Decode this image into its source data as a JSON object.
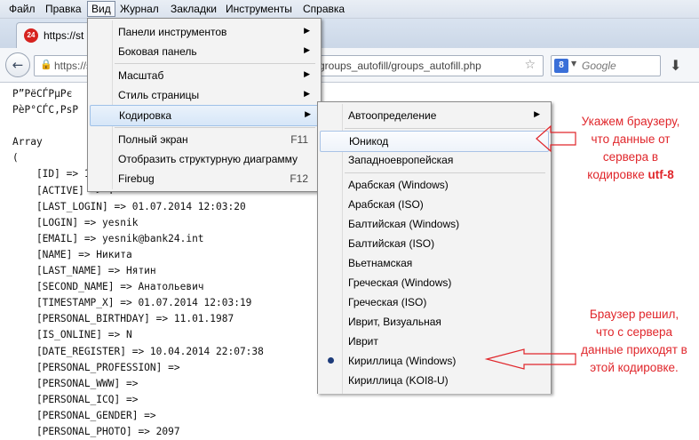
{
  "menubar": {
    "items": [
      "Файл",
      "Правка",
      "Вид",
      "Журнал",
      "Закладки",
      "Инструменты",
      "Справка"
    ],
    "active": "Вид"
  },
  "tab": {
    "favicon_text": "24",
    "title": "https://st"
  },
  "navbar": {
    "url_visible_start": "https://s",
    "url_visible_end": "groups_autofill/groups_autofill.php",
    "search_placeholder": "Google",
    "search_engine_icon": "google-icon",
    "download_icon": "download-arrow-icon"
  },
  "page": {
    "lines": [
      "Р”РёСЃРµРє",
      "РѐР°СЃС‚РѕР",
      "",
      "Array",
      "(",
      "    [ID] => 1",
      "    [ACTIVE] => Y",
      "    [LAST_LOGIN] => 01.07.2014 12:03:20",
      "    [LOGIN] => yesnik",
      "    [EMAIL] => yesnik@bank24.int",
      "    [NAME] => Никита",
      "    [LAST_NAME] => Нятин",
      "    [SECOND_NAME] => Анатольевич",
      "    [TIMESTAMP_X] => 01.07.2014 12:03:19",
      "    [PERSONAL_BIRTHDAY] => 11.01.1987",
      "    [IS_ONLINE] => N",
      "    [DATE_REGISTER] => 10.04.2014 22:07:38",
      "    [PERSONAL_PROFESSION] =>",
      "    [PERSONAL_WWW] =>",
      "    [PERSONAL_ICQ] =>",
      "    [PERSONAL_GENDER] =>",
      "    [PERSONAL_PHOTO] => 2097"
    ]
  },
  "view_menu": {
    "items": [
      {
        "label": "Панели инструментов",
        "submenu": true
      },
      {
        "label": "Боковая панель",
        "submenu": true
      },
      {
        "label": "Масштаб",
        "submenu": true
      },
      {
        "label": "Стиль страницы",
        "submenu": true
      },
      {
        "label": "Кодировка",
        "submenu": true,
        "highlighted": true
      },
      {
        "label": "Полный экран",
        "shortcut": "F11"
      },
      {
        "label": "Отобразить структурную диаграмму"
      },
      {
        "label": "Firebug",
        "shortcut": "F12"
      }
    ]
  },
  "encoding_menu": {
    "items": [
      {
        "label": "Автоопределение",
        "submenu": true
      },
      {
        "label": "Юникод",
        "highlighted": true
      },
      {
        "label": "Западноевропейская"
      },
      {
        "label": "Арабская (Windows)"
      },
      {
        "label": "Арабская (ISO)"
      },
      {
        "label": "Балтийская (Windows)"
      },
      {
        "label": "Балтийская (ISO)"
      },
      {
        "label": "Вьетнамская"
      },
      {
        "label": "Греческая (Windows)"
      },
      {
        "label": "Греческая (ISO)"
      },
      {
        "label": "Иврит, Визуальная"
      },
      {
        "label": "Иврит"
      },
      {
        "label": "Кириллица (Windows)",
        "selected": true
      },
      {
        "label": "Кириллица (KOI8-U)"
      }
    ]
  },
  "annotations": {
    "note1_lines": [
      "Укажем браузеру,",
      "что данные от",
      "сервера в"
    ],
    "note1_last_prefix": "кодировке ",
    "note1_last_bold": "utf-8",
    "note2_lines": [
      "Браузер решил,",
      "что с сервера",
      "данные приходят в",
      "этой кодировке."
    ],
    "color": "#e0262b"
  }
}
